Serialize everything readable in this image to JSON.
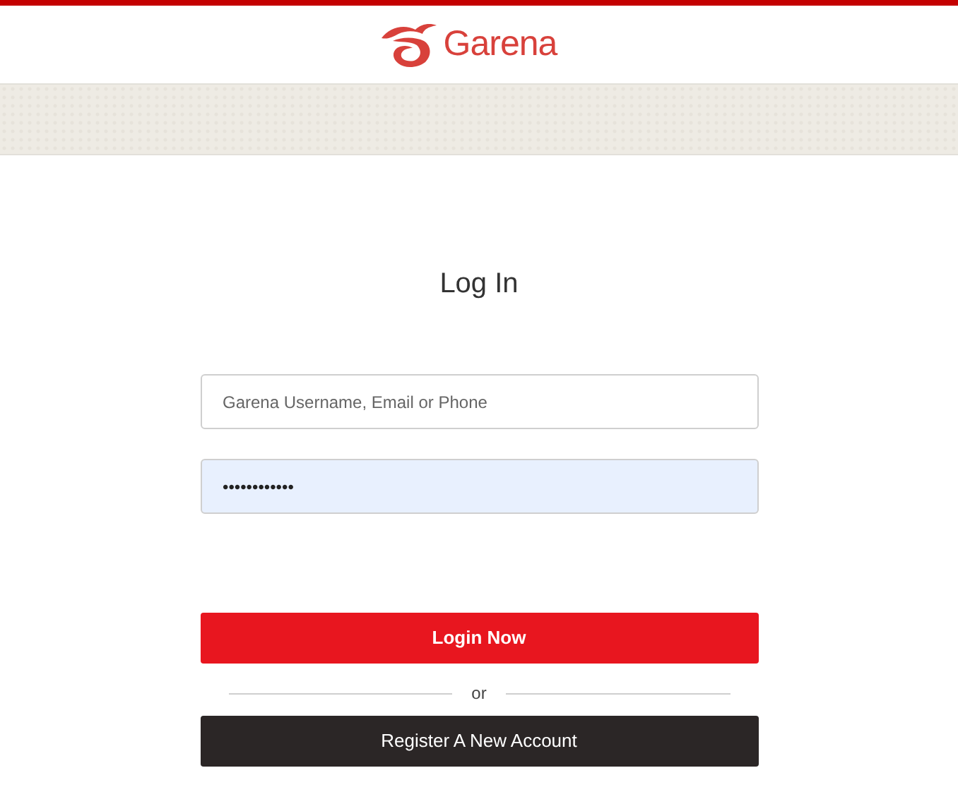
{
  "header": {
    "brand": "Garena"
  },
  "login": {
    "title": "Log In",
    "username": {
      "placeholder": "Garena Username, Email or Phone"
    },
    "password": {
      "value": "••••••••••••",
      "autofilled": true
    },
    "login_button": "Login Now",
    "separator": "or",
    "register_button": "Register A New Account"
  }
}
